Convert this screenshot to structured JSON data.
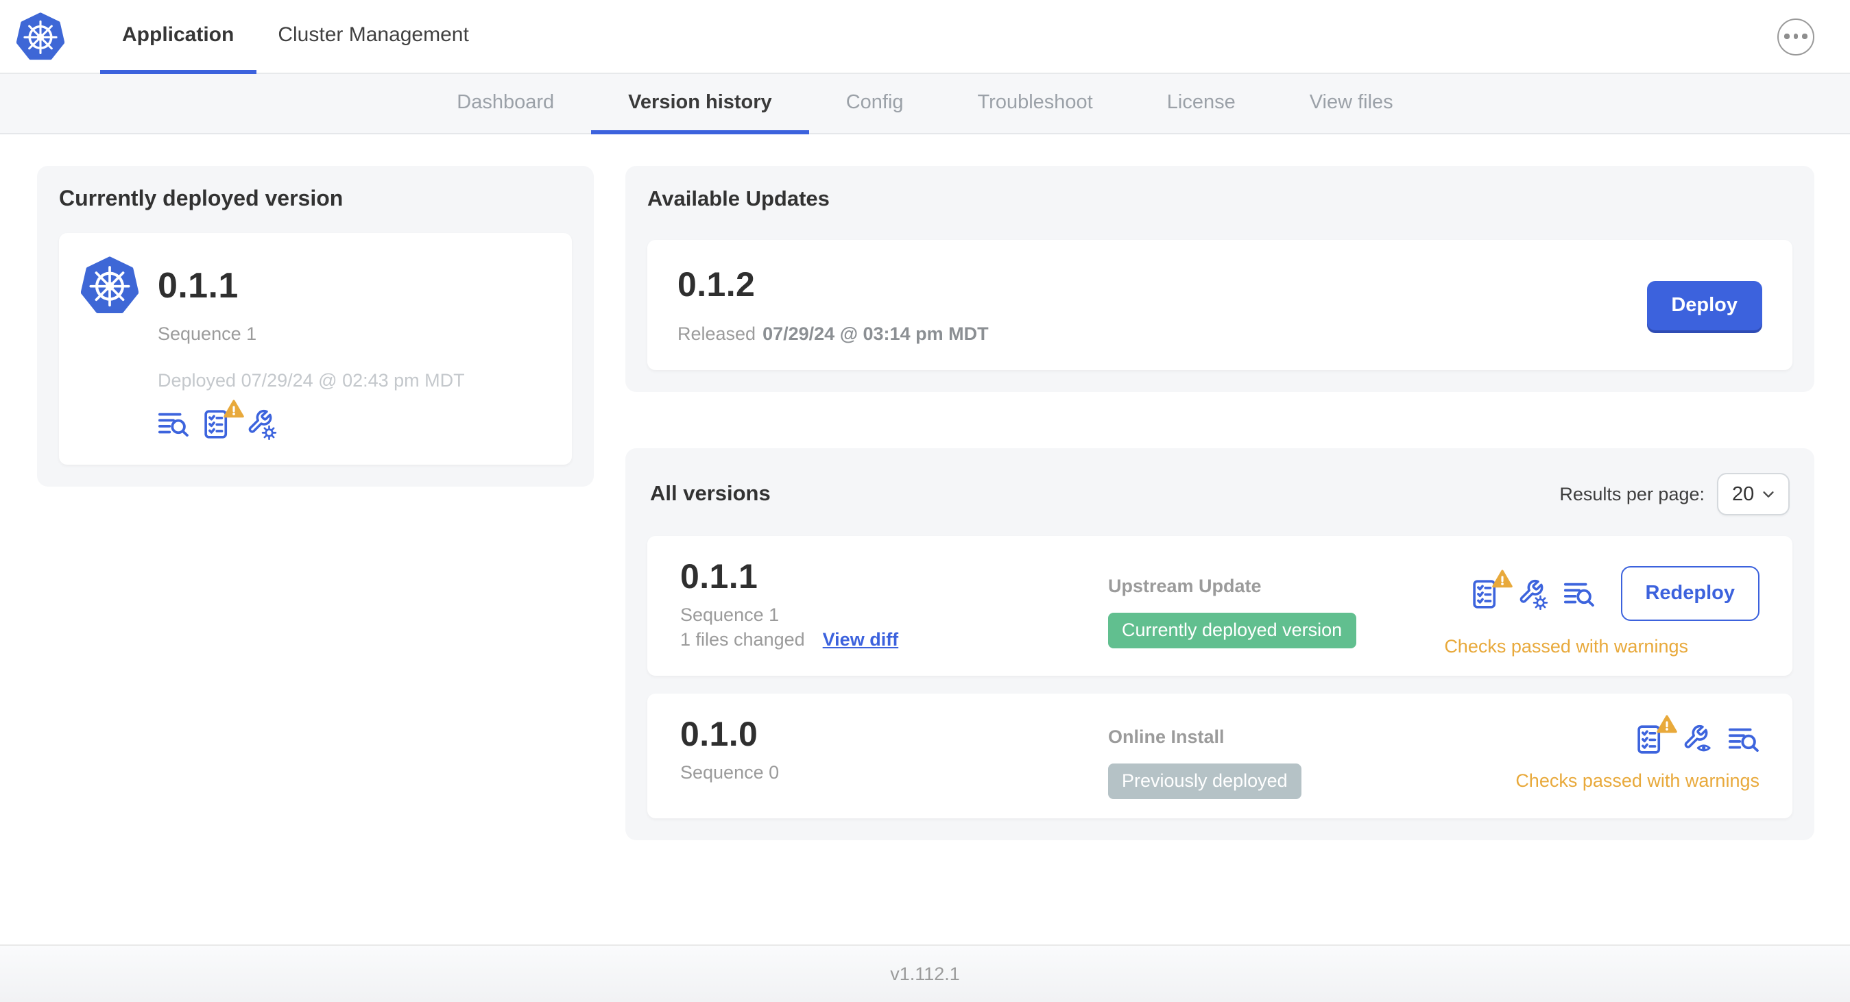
{
  "header": {
    "tabs": [
      {
        "label": "Application",
        "active": true
      },
      {
        "label": "Cluster Management",
        "active": false
      }
    ]
  },
  "subnav": {
    "tabs": [
      {
        "label": "Dashboard",
        "active": false
      },
      {
        "label": "Version history",
        "active": true
      },
      {
        "label": "Config",
        "active": false
      },
      {
        "label": "Troubleshoot",
        "active": false
      },
      {
        "label": "License",
        "active": false
      },
      {
        "label": "View files",
        "active": false
      }
    ]
  },
  "current_version": {
    "title": "Currently deployed version",
    "version": "0.1.1",
    "sequence": "Sequence 1",
    "deployed": "Deployed 07/29/24 @ 02:43 pm MDT"
  },
  "available_updates": {
    "title": "Available Updates",
    "version": "0.1.2",
    "released_prefix": "Released",
    "released_date": "07/29/24 @ 03:14 pm MDT",
    "deploy_label": "Deploy"
  },
  "all_versions": {
    "title": "All versions",
    "results_per_page_label": "Results per page:",
    "results_per_page_value": "20",
    "rows": [
      {
        "version": "0.1.1",
        "sequence": "Sequence 1",
        "files_changed": "1 files changed",
        "view_diff_label": "View diff",
        "source": "Upstream Update",
        "badge": "Currently deployed version",
        "badge_color": "green",
        "action_label": "Redeploy",
        "status": "Checks passed with warnings"
      },
      {
        "version": "0.1.0",
        "sequence": "Sequence 0",
        "source": "Online Install",
        "badge": "Previously deployed",
        "badge_color": "gray",
        "status": "Checks passed with warnings"
      }
    ]
  },
  "footer": {
    "version": "v1.112.1"
  },
  "colors": {
    "accent_blue": "#3c62dd",
    "logo_blue": "#3e67d6",
    "badge_green": "#61bf8f",
    "badge_gray": "#b5c2c6",
    "warning_orange": "#e8a93b",
    "panel_gray": "#f5f6f8"
  }
}
